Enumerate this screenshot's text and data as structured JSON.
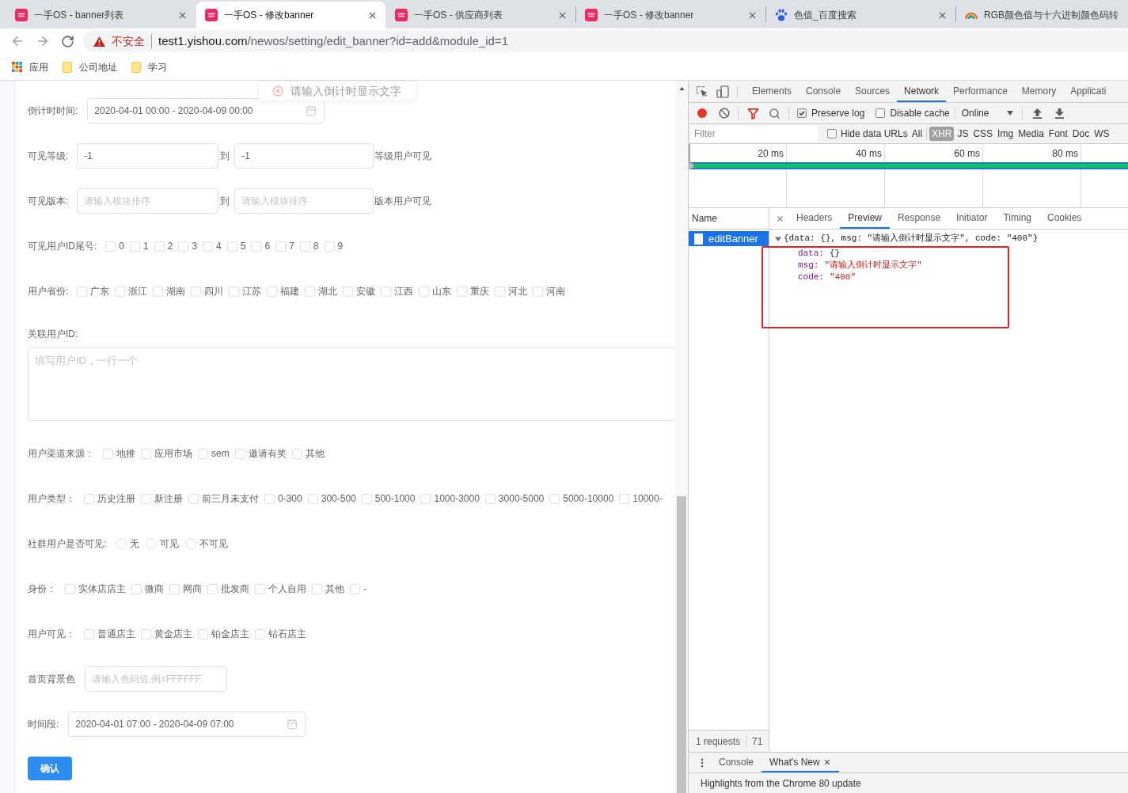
{
  "browser": {
    "tabs": [
      {
        "kind": "app",
        "title": "一手OS - banner列表",
        "selected": false
      },
      {
        "kind": "app",
        "title": "一手OS - 修改banner",
        "selected": true
      },
      {
        "kind": "app",
        "title": "一手OS - 供应商列表",
        "selected": false
      },
      {
        "kind": "app",
        "title": "一手OS - 修改banner",
        "selected": false
      },
      {
        "kind": "paw",
        "title": "色值_百度搜索",
        "selected": false
      },
      {
        "kind": "rainbow",
        "title": "RGB颜色值与十六进制颜色码转",
        "selected": false
      }
    ],
    "address": {
      "security": "不安全",
      "host": "test1.yishou.com",
      "path": "/newos/setting/edit_banner?id=add&module_id=1"
    },
    "bookmarks": [
      {
        "kind": "apps",
        "label": "应用"
      },
      {
        "kind": "folder",
        "label": "公司地址"
      },
      {
        "kind": "folder",
        "label": "学习"
      }
    ]
  },
  "page": {
    "toast": {
      "message": "请输入倒计时显示文字"
    },
    "rows": [
      {
        "kind": "date_range",
        "label": "倒计时时间:",
        "value": "2020-04-01 00:00 - 2020-04-09 00:00"
      },
      {
        "kind": "range",
        "label": "可见等级:",
        "from": {
          "value": "-1"
        },
        "separator": "到",
        "to": {
          "value": "-1"
        },
        "suffix": "等级用户可见"
      },
      {
        "kind": "range",
        "label": "可见版本:",
        "from": {
          "placeholder": "请输入模块排序"
        },
        "separator": "到",
        "to": {
          "placeholder": "请输入模块排序"
        },
        "suffix": "版本用户可见"
      },
      {
        "kind": "checkboxes",
        "label": "可见用户ID尾号:",
        "options": [
          {
            "label": "0",
            "checked": false
          },
          {
            "label": "1",
            "checked": false
          },
          {
            "label": "2",
            "checked": false
          },
          {
            "label": "3",
            "checked": false
          },
          {
            "label": "4",
            "checked": false
          },
          {
            "label": "5",
            "checked": false
          },
          {
            "label": "6",
            "checked": false
          },
          {
            "label": "7",
            "checked": false
          },
          {
            "label": "8",
            "checked": false
          },
          {
            "label": "9",
            "checked": false
          }
        ]
      },
      {
        "kind": "checkboxes",
        "label": "用户省份:",
        "options": [
          {
            "label": "广东",
            "checked": false
          },
          {
            "label": "浙江",
            "checked": false
          },
          {
            "label": "湖南",
            "checked": false
          },
          {
            "label": "四川",
            "checked": false
          },
          {
            "label": "江苏",
            "checked": false
          },
          {
            "label": "福建",
            "checked": false
          },
          {
            "label": "湖北",
            "checked": false
          },
          {
            "label": "安徽",
            "checked": false
          },
          {
            "label": "江西",
            "checked": false
          },
          {
            "label": "山东",
            "checked": false
          },
          {
            "label": "重庆",
            "checked": false
          },
          {
            "label": "河北",
            "checked": false
          },
          {
            "label": "河南",
            "checked": false
          }
        ]
      },
      {
        "kind": "textarea",
        "label": "关联用户ID:",
        "placeholder": "填写用户ID，一行一个"
      },
      {
        "kind": "checkboxes",
        "label": "用户渠道来源：",
        "options": [
          {
            "label": "地推",
            "checked": false
          },
          {
            "label": "应用市场",
            "checked": false
          },
          {
            "label": "sem",
            "checked": false
          },
          {
            "label": "邀请有奖",
            "checked": false
          },
          {
            "label": "其他",
            "checked": false
          }
        ]
      },
      {
        "kind": "checkboxes",
        "label": "用户类型：",
        "options": [
          {
            "label": "历史注册",
            "checked": false
          },
          {
            "label": "新注册",
            "checked": false
          },
          {
            "label": "前三月未支付",
            "checked": false
          },
          {
            "label": "0-300",
            "checked": false
          },
          {
            "label": "300-500",
            "checked": false
          },
          {
            "label": "500-1000",
            "checked": false
          },
          {
            "label": "1000-3000",
            "checked": false
          },
          {
            "label": "3000-5000",
            "checked": false
          },
          {
            "label": "5000-10000",
            "checked": false
          },
          {
            "label": "10000-",
            "checked": false
          }
        ]
      },
      {
        "kind": "radios",
        "label": "社群用户是否可见:",
        "options": [
          {
            "label": "无",
            "selected": false
          },
          {
            "label": "可见",
            "selected": false
          },
          {
            "label": "不可见",
            "selected": false
          }
        ]
      },
      {
        "kind": "checkboxes",
        "label": "身份：",
        "options": [
          {
            "label": "实体店店主",
            "checked": false
          },
          {
            "label": "微商",
            "checked": false
          },
          {
            "label": "网商",
            "checked": false
          },
          {
            "label": "批发商",
            "checked": false
          },
          {
            "label": "个人自用",
            "checked": false
          },
          {
            "label": "其他",
            "checked": false
          },
          {
            "label": "-",
            "checked": false
          }
        ]
      },
      {
        "kind": "checkboxes",
        "label": "用户可见：",
        "options": [
          {
            "label": "普通店主",
            "checked": false
          },
          {
            "label": "黄金店主",
            "checked": false
          },
          {
            "label": "铂金店主",
            "checked": false
          },
          {
            "label": "钻石店主",
            "checked": false
          }
        ]
      },
      {
        "kind": "input",
        "label": "首页背景色",
        "placeholder": "请输入色码值,例#FFFFFF"
      },
      {
        "kind": "date_range",
        "label": "时间段:",
        "value": "2020-04-01 07:00 - 2020-04-09 07:00"
      }
    ],
    "submit": "确认"
  },
  "devtools": {
    "tabs": [
      {
        "label": "Elements",
        "selected": false
      },
      {
        "label": "Console",
        "selected": false
      },
      {
        "label": "Sources",
        "selected": false
      },
      {
        "label": "Network",
        "selected": true
      },
      {
        "label": "Performance",
        "selected": false
      },
      {
        "label": "Memory",
        "selected": false
      },
      {
        "label": "Applicati",
        "selected": false
      }
    ],
    "network": {
      "recording": true,
      "preserve_log": {
        "label": "Preserve log",
        "checked": true
      },
      "disable_cache": {
        "label": "Disable cache",
        "checked": false
      },
      "throttling": "Online",
      "filter": {
        "placeholder": "Filter"
      },
      "hide_data_urls": {
        "label": "Hide data URLs",
        "checked": false
      },
      "types": [
        {
          "label": "All",
          "selected": false
        },
        {
          "label": "XHR",
          "selected": true
        },
        {
          "label": "JS",
          "selected": false
        },
        {
          "label": "CSS",
          "selected": false
        },
        {
          "label": "Img",
          "selected": false
        },
        {
          "label": "Media",
          "selected": false
        },
        {
          "label": "Font",
          "selected": false
        },
        {
          "label": "Doc",
          "selected": false
        },
        {
          "label": "WS",
          "selected": false
        }
      ],
      "overview_ticks": [
        "20 ms",
        "40 ms",
        "60 ms",
        "80 ms"
      ],
      "name_column": "Name",
      "requests": [
        {
          "name": "editBanner",
          "selected": true
        }
      ],
      "request_count": "1 requests",
      "transfer": "71",
      "detail_tabs": [
        {
          "label": "Headers",
          "selected": false
        },
        {
          "label": "Preview",
          "selected": true
        },
        {
          "label": "Response",
          "selected": false
        },
        {
          "label": "Initiator",
          "selected": false
        },
        {
          "label": "Timing",
          "selected": false
        },
        {
          "label": "Cookies",
          "selected": false
        }
      ],
      "preview": {
        "expanded": true,
        "summary": "{data: {}, msg: \"请输入倒计时显示文字\", code: \"400\"}",
        "properties": [
          {
            "kind": "object",
            "key": "data:",
            "value": "{}"
          },
          {
            "kind": "string",
            "key": "msg:",
            "value": "\"请输入倒计时显示文字\""
          },
          {
            "kind": "string",
            "key": "code:",
            "value": "\"400\""
          }
        ]
      }
    },
    "drawer": {
      "tabs": [
        {
          "label": "Console",
          "selected": false,
          "closable": false
        },
        {
          "label": "What's New",
          "selected": true,
          "closable": true
        }
      ],
      "message": "Highlights from the Chrome 80 update"
    }
  }
}
